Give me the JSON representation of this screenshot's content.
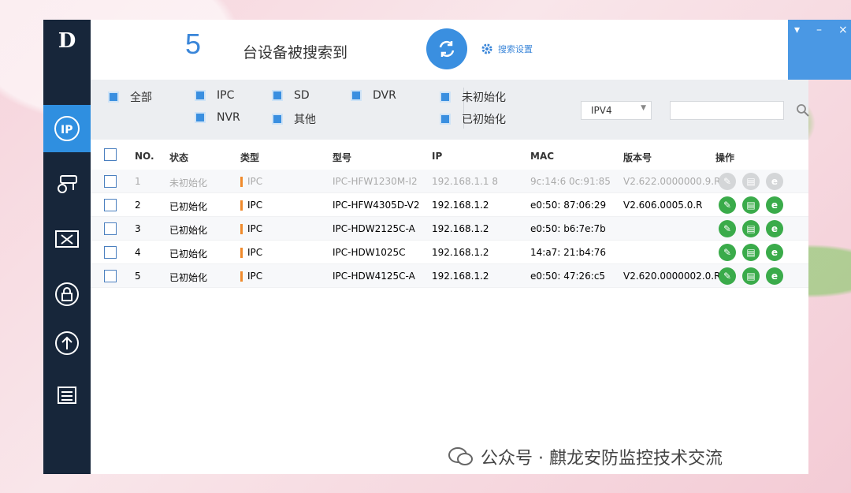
{
  "app": {
    "logo": "D"
  },
  "header": {
    "count": "5",
    "count_label": "台设备被搜索到",
    "search_settings": "搜索设置",
    "controls": {
      "pin": "▾",
      "minimize": "–",
      "close": "×"
    }
  },
  "filters": {
    "all": "全部",
    "ipc": "IPC",
    "sd": "SD",
    "dvr": "DVR",
    "nvr": "NVR",
    "other": "其他",
    "uninit": "未初始化",
    "init": "已初始化",
    "ip_version": "IPV4"
  },
  "table": {
    "headers": {
      "no": "NO.",
      "status": "状态",
      "type": "类型",
      "model": "型号",
      "ip": "IP",
      "mac": "MAC",
      "version": "版本号",
      "ops": "操作"
    },
    "rows": [
      {
        "no": "1",
        "status": "未初始化",
        "type": "IPC",
        "model": "IPC-HFW1230M-I2",
        "ip": "192.168.1.1 8",
        "mac": "9c:14:6  0c:91:85",
        "version": "V2.622.0000000.9.R",
        "disabled": true
      },
      {
        "no": "2",
        "status": "已初始化",
        "type": "IPC",
        "model": "IPC-HFW4305D-V2",
        "ip": "192.168.1.2",
        "mac": "e0:50:  87:06:29",
        "version": "V2.606.0005.0.R",
        "disabled": false
      },
      {
        "no": "3",
        "status": "已初始化",
        "type": "IPC",
        "model": "IPC-HDW2125C-A",
        "ip": "192.168.1.2",
        "mac": "e0:50:  b6:7e:7b",
        "version": "",
        "disabled": false
      },
      {
        "no": "4",
        "status": "已初始化",
        "type": "IPC",
        "model": "IPC-HDW1025C",
        "ip": "192.168.1.2",
        "mac": "14:a7:  21:b4:76",
        "version": "",
        "disabled": false
      },
      {
        "no": "5",
        "status": "已初始化",
        "type": "IPC",
        "model": "IPC-HDW4125C-A",
        "ip": "192.168.1.2",
        "mac": "e0:50:  47:26:c5",
        "version": "V2.620.0000002.0.R",
        "disabled": false
      }
    ]
  },
  "watermark": {
    "text": "公众号 · 麒龙安防监控技术交流"
  },
  "colors": {
    "accent": "#3a8fe0",
    "sidebar": "#17263a",
    "ok": "#3aab4a",
    "type_bar": "#f08a2b"
  }
}
